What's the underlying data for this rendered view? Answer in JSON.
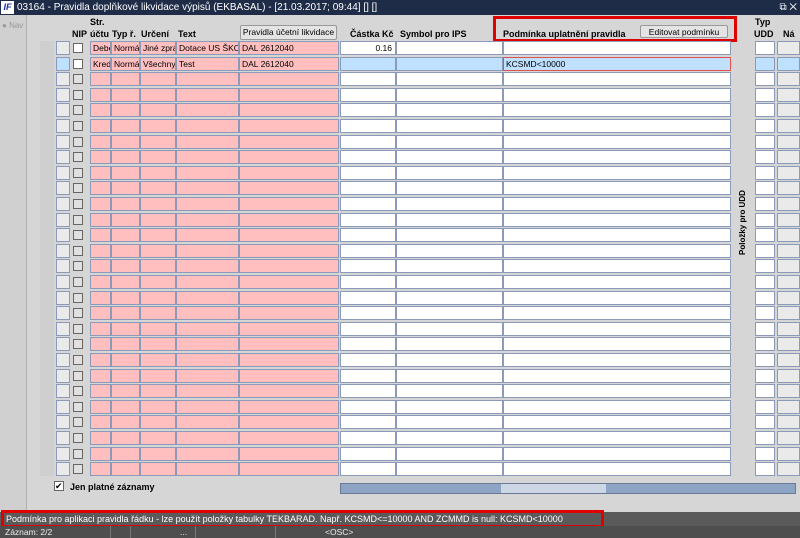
{
  "window": {
    "title": "03164 - Pravidla doplňkové likvidace výpisů (EKBASAL) - [21.03.2017; 09:44]  [] []",
    "logo": "IF",
    "controls": "⧉ ✕"
  },
  "nav": {
    "label": "Nav"
  },
  "headers": {
    "nip": "NIP",
    "str_line1": "Str.",
    "str_line2": "účtu",
    "typ": "Typ ř.",
    "urceni": "Určení",
    "text": "Text",
    "pravidla_button": "Pravidla účetní likvidace",
    "castka": "Částka Kč",
    "symbol": "Symbol pro IPS",
    "podminka": "Podmínka uplatnění pravidla",
    "edit_button": "Editovat podmínku",
    "typ_udd_line1": "Typ",
    "typ_udd_line2": "UDD",
    "na": "Ná"
  },
  "side_label": "Položky pro UDD",
  "rows": [
    {
      "str": "Debe",
      "typ": "Normá",
      "urceni": "Jiné zprá",
      "text": "Dotace US ŠKO",
      "pravidla": "DAL 2612040",
      "castka": "0.16",
      "symbol": "",
      "podminka": "",
      "selected": false
    },
    {
      "str": "Kred",
      "typ": "Normá",
      "urceni": "Všechny",
      "text": "Test",
      "pravidla": "DAL 2612040",
      "castka": "",
      "symbol": "",
      "podminka": "KCSMD<10000",
      "selected": true
    }
  ],
  "empty_rows": 26,
  "filter": {
    "label": "Jen platné záznamy",
    "checked": true
  },
  "status": {
    "hint": "Podmínka pro aplikaci pravidla řádku - lze použít položky tabulky TEKBARAD. Např. KCSMD<=10000 AND ZCMMD is null: KCSMD<10000",
    "record": "Záznam: 2/2",
    "dots": "...",
    "osc": "<OSC>"
  }
}
